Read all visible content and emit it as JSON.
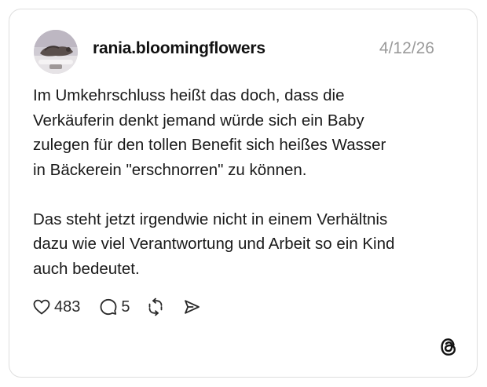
{
  "post": {
    "username": "rania.bloomingflowers",
    "date": "4/12/26",
    "paragraphs": [
      "Im Umkehrschluss heißt das doch, dass die Verkäuferin denkt jemand würde sich ein Baby zulegen für den tollen Benefit sich heißes Wasser in Bäckerein \"erschnorren\" zu können.",
      "Das steht jetzt irgendwie nicht in einem Verhältnis dazu wie viel Verantwortung und Arbeit so ein Kind auch bedeutet."
    ],
    "paragraph_lines": [
      [
        "Im Umkehrschluss heißt das doch, dass die",
        "Verkäuferin denkt jemand würde sich ein Baby",
        "zulegen für den tollen Benefit sich heißes Wasser",
        "in Bäckerein \"erschnorren\" zu können."
      ],
      [
        "Das steht jetzt irgendwie nicht in einem Verhältnis",
        "dazu wie viel Verantwortung und Arbeit so ein Kind",
        "auch bedeutet."
      ]
    ]
  },
  "actions": {
    "likes": "483",
    "comments": "5",
    "icons": [
      "heart-icon",
      "comment-icon",
      "repost-icon",
      "share-icon"
    ]
  },
  "branding": {
    "logo": "threads-logo-icon"
  },
  "colors": {
    "background": "#ffffff",
    "border": "#dedede",
    "text": "#1a1a1a",
    "muted": "#9a9a9a",
    "icon": "#2a2a2a"
  }
}
